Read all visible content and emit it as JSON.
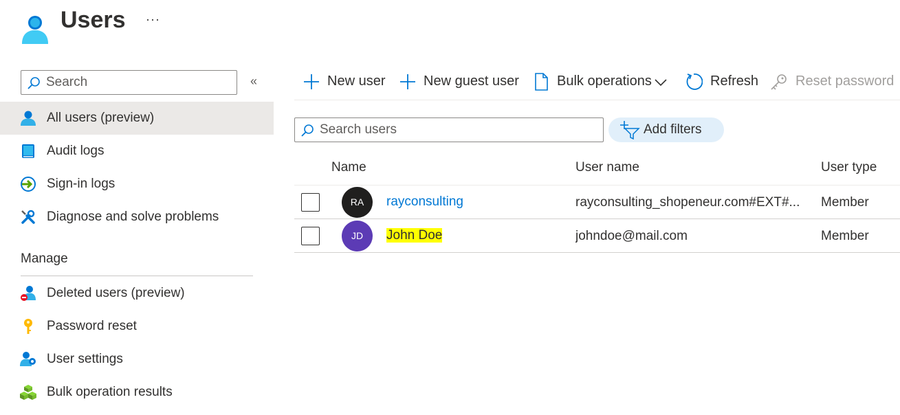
{
  "header": {
    "title": "Users",
    "more_label": "···"
  },
  "sidebar": {
    "search_placeholder": "Search",
    "collapse_label": "«",
    "items": [
      {
        "label": "All users (preview)",
        "icon": "user-icon",
        "active": true
      },
      {
        "label": "Audit logs",
        "icon": "audit-log-icon"
      },
      {
        "label": "Sign-in logs",
        "icon": "sign-in-icon"
      },
      {
        "label": "Diagnose and solve problems",
        "icon": "wrench-icon"
      }
    ],
    "section_title": "Manage",
    "manage_items": [
      {
        "label": "Deleted users (preview)",
        "icon": "deleted-user-icon"
      },
      {
        "label": "Password reset",
        "icon": "key-icon"
      },
      {
        "label": "User settings",
        "icon": "user-settings-icon"
      },
      {
        "label": "Bulk operation results",
        "icon": "cubes-icon"
      }
    ]
  },
  "toolbar": {
    "new_user": "New user",
    "new_guest_user": "New guest user",
    "bulk_operations": "Bulk operations",
    "refresh": "Refresh",
    "reset_password": "Reset password"
  },
  "filters": {
    "search_placeholder": "Search users",
    "add_filters": "Add filters"
  },
  "table": {
    "columns": [
      "Name",
      "User name",
      "User type"
    ],
    "rows": [
      {
        "initials": "RA",
        "avatar_color": "#201f1e",
        "name": "rayconsulting",
        "user_name": "rayconsulting_shopeneur.com#EXT#...",
        "user_type": "Member"
      },
      {
        "initials": "JD",
        "avatar_color": "#5c3bb5",
        "name": "John Doe",
        "user_name": "johndoe@mail.com",
        "user_type": "Member"
      }
    ]
  },
  "colors": {
    "accent": "#0078d4",
    "active_nav_bg": "#ebe9e7",
    "highlight": "#ffff00"
  }
}
